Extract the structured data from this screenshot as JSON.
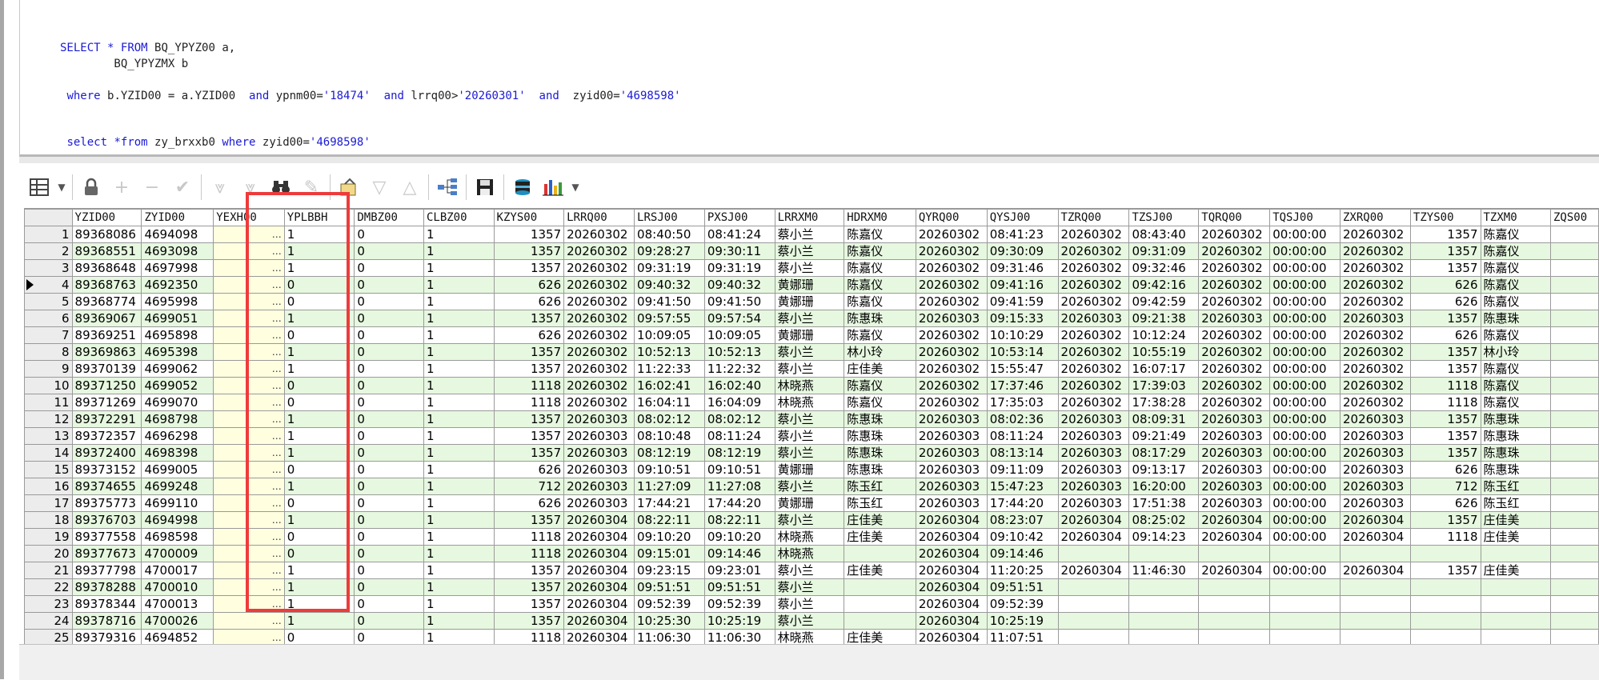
{
  "sql": {
    "line1": "SELECT * FROM BQ_YPYZ00 a,",
    "line2": "        BQ_YPYZMX b",
    "line3": " where b.YZID00 = a.YZID00  and ypnm00='18474'  and lrrq00>'20260301'  and  zyid00='4698598'",
    "line4": " select *from zy_brxxb0 where zyid00='4698598'"
  },
  "toolbar": {
    "icons": [
      "grid-icon",
      "dropdown-icon",
      "lock-icon",
      "plus-icon",
      "minus-icon",
      "check-icon",
      "down-double-icon",
      "down-double-icon",
      "binoculars-icon",
      "eraser-icon",
      "export-icon",
      "down-icon",
      "up-icon",
      "tree-icon",
      "save-icon",
      "db-icon",
      "chart-icon",
      "dropdown-icon"
    ]
  },
  "columns": [
    "YZID00",
    "ZYID00",
    "YEXH00",
    "YPLBBH",
    "DMBZ00",
    "CLBZ00",
    "KZYS00",
    "LRRQ00",
    "LRSJ00",
    "PXSJ00",
    "LRRXM0",
    "HDRXM0",
    "QYRQ00",
    "QYSJ00",
    "TZRQ00",
    "TZSJ00",
    "TQRQ00",
    "TQSJ00",
    "ZXRQ00",
    "TZYS00",
    "TZXM0",
    "ZQS00"
  ],
  "rows": [
    [
      "1",
      "89368086",
      "4694098",
      "…",
      "1",
      "0",
      "1",
      "1357",
      "20260302",
      "08:40:50",
      "08:41:24",
      "蔡小兰",
      "陈嘉仪",
      "20260302",
      "08:41:23",
      "20260302",
      "08:43:40",
      "20260302",
      "00:00:00",
      "20260302",
      "1357",
      "陈嘉仪"
    ],
    [
      "2",
      "89368551",
      "4693098",
      "…",
      "1",
      "0",
      "1",
      "1357",
      "20260302",
      "09:28:27",
      "09:30:11",
      "蔡小兰",
      "陈嘉仪",
      "20260302",
      "09:30:09",
      "20260302",
      "09:31:09",
      "20260302",
      "00:00:00",
      "20260302",
      "1357",
      "陈嘉仪"
    ],
    [
      "3",
      "89368648",
      "4697998",
      "…",
      "1",
      "0",
      "1",
      "1357",
      "20260302",
      "09:31:19",
      "09:31:19",
      "蔡小兰",
      "陈嘉仪",
      "20260302",
      "09:31:46",
      "20260302",
      "09:32:46",
      "20260302",
      "00:00:00",
      "20260302",
      "1357",
      "陈嘉仪"
    ],
    [
      "4",
      "89368763",
      "4692350",
      "…",
      "0",
      "0",
      "1",
      "626",
      "20260302",
      "09:40:32",
      "09:40:32",
      "黄娜珊",
      "陈嘉仪",
      "20260302",
      "09:41:16",
      "20260302",
      "09:42:16",
      "20260302",
      "00:00:00",
      "20260302",
      "626",
      "陈嘉仪"
    ],
    [
      "5",
      "89368774",
      "4695998",
      "…",
      "0",
      "0",
      "1",
      "626",
      "20260302",
      "09:41:50",
      "09:41:50",
      "黄娜珊",
      "陈嘉仪",
      "20260302",
      "09:41:59",
      "20260302",
      "09:42:59",
      "20260302",
      "00:00:00",
      "20260302",
      "626",
      "陈嘉仪"
    ],
    [
      "6",
      "89369067",
      "4699051",
      "…",
      "1",
      "0",
      "1",
      "1357",
      "20260302",
      "09:57:55",
      "09:57:54",
      "蔡小兰",
      "陈惠珠",
      "20260303",
      "09:15:33",
      "20260303",
      "09:21:38",
      "20260303",
      "00:00:00",
      "20260303",
      "1357",
      "陈惠珠"
    ],
    [
      "7",
      "89369251",
      "4695898",
      "…",
      "0",
      "0",
      "1",
      "626",
      "20260302",
      "10:09:05",
      "10:09:05",
      "黄娜珊",
      "陈嘉仪",
      "20260302",
      "10:10:29",
      "20260302",
      "10:12:24",
      "20260302",
      "00:00:00",
      "20260302",
      "626",
      "陈嘉仪"
    ],
    [
      "8",
      "89369863",
      "4695398",
      "…",
      "1",
      "0",
      "1",
      "1357",
      "20260302",
      "10:52:13",
      "10:52:13",
      "蔡小兰",
      "林小玲",
      "20260302",
      "10:53:14",
      "20260302",
      "10:55:19",
      "20260302",
      "00:00:00",
      "20260302",
      "1357",
      "林小玲"
    ],
    [
      "9",
      "89370139",
      "4699062",
      "…",
      "1",
      "0",
      "1",
      "1357",
      "20260302",
      "11:22:33",
      "11:22:32",
      "蔡小兰",
      "庄佳美",
      "20260302",
      "15:55:47",
      "20260302",
      "16:07:17",
      "20260302",
      "00:00:00",
      "20260302",
      "1357",
      "陈嘉仪"
    ],
    [
      "10",
      "89371250",
      "4699052",
      "…",
      "0",
      "0",
      "1",
      "1118",
      "20260302",
      "16:02:41",
      "16:02:40",
      "林晓燕",
      "陈嘉仪",
      "20260302",
      "17:37:46",
      "20260302",
      "17:39:03",
      "20260302",
      "00:00:00",
      "20260302",
      "1118",
      "陈嘉仪"
    ],
    [
      "11",
      "89371269",
      "4699070",
      "…",
      "0",
      "0",
      "1",
      "1118",
      "20260302",
      "16:04:11",
      "16:04:09",
      "林晓燕",
      "陈嘉仪",
      "20260302",
      "17:35:03",
      "20260302",
      "17:38:28",
      "20260302",
      "00:00:00",
      "20260302",
      "1118",
      "陈嘉仪"
    ],
    [
      "12",
      "89372291",
      "4698798",
      "…",
      "1",
      "0",
      "1",
      "1357",
      "20260303",
      "08:02:12",
      "08:02:12",
      "蔡小兰",
      "陈惠珠",
      "20260303",
      "08:02:36",
      "20260303",
      "08:09:31",
      "20260303",
      "00:00:00",
      "20260303",
      "1357",
      "陈惠珠"
    ],
    [
      "13",
      "89372357",
      "4696298",
      "…",
      "1",
      "0",
      "1",
      "1357",
      "20260303",
      "08:10:48",
      "08:11:24",
      "蔡小兰",
      "陈惠珠",
      "20260303",
      "08:11:24",
      "20260303",
      "09:21:49",
      "20260303",
      "00:00:00",
      "20260303",
      "1357",
      "陈惠珠"
    ],
    [
      "14",
      "89372400",
      "4698398",
      "…",
      "1",
      "0",
      "1",
      "1357",
      "20260303",
      "08:12:19",
      "08:12:19",
      "蔡小兰",
      "陈惠珠",
      "20260303",
      "08:13:14",
      "20260303",
      "08:17:29",
      "20260303",
      "00:00:00",
      "20260303",
      "1357",
      "陈惠珠"
    ],
    [
      "15",
      "89373152",
      "4699005",
      "…",
      "0",
      "0",
      "1",
      "626",
      "20260303",
      "09:10:51",
      "09:10:51",
      "黄娜珊",
      "陈惠珠",
      "20260303",
      "09:11:09",
      "20260303",
      "09:13:17",
      "20260303",
      "00:00:00",
      "20260303",
      "626",
      "陈惠珠"
    ],
    [
      "16",
      "89374655",
      "4699248",
      "…",
      "1",
      "0",
      "1",
      "712",
      "20260303",
      "11:27:09",
      "11:27:08",
      "蔡小兰",
      "陈玉红",
      "20260303",
      "15:47:23",
      "20260303",
      "16:20:00",
      "20260303",
      "00:00:00",
      "20260303",
      "712",
      "陈玉红"
    ],
    [
      "17",
      "89375773",
      "4699110",
      "…",
      "0",
      "0",
      "1",
      "626",
      "20260303",
      "17:44:21",
      "17:44:20",
      "黄娜珊",
      "陈玉红",
      "20260303",
      "17:44:20",
      "20260303",
      "17:51:38",
      "20260303",
      "00:00:00",
      "20260303",
      "626",
      "陈玉红"
    ],
    [
      "18",
      "89376703",
      "4694998",
      "…",
      "1",
      "0",
      "1",
      "1357",
      "20260304",
      "08:22:11",
      "08:22:11",
      "蔡小兰",
      "庄佳美",
      "20260304",
      "08:23:07",
      "20260304",
      "08:25:02",
      "20260304",
      "00:00:00",
      "20260304",
      "1357",
      "庄佳美"
    ],
    [
      "19",
      "89377558",
      "4698598",
      "…",
      "0",
      "0",
      "1",
      "1118",
      "20260304",
      "09:10:20",
      "09:10:20",
      "林晓燕",
      "庄佳美",
      "20260304",
      "09:10:42",
      "20260304",
      "09:14:23",
      "20260304",
      "00:00:00",
      "20260304",
      "1118",
      "庄佳美"
    ],
    [
      "20",
      "89377673",
      "4700009",
      "…",
      "0",
      "0",
      "1",
      "1118",
      "20260304",
      "09:15:01",
      "09:14:46",
      "林晓燕",
      "",
      "20260304",
      "09:14:46",
      "",
      "",
      "",
      "",
      "",
      "",
      ""
    ],
    [
      "21",
      "89377798",
      "4700017",
      "…",
      "1",
      "0",
      "1",
      "1357",
      "20260304",
      "09:23:15",
      "09:23:01",
      "蔡小兰",
      "庄佳美",
      "20260304",
      "11:20:25",
      "20260304",
      "11:46:30",
      "20260304",
      "00:00:00",
      "20260304",
      "1357",
      "庄佳美"
    ],
    [
      "22",
      "89378288",
      "4700010",
      "…",
      "1",
      "0",
      "1",
      "1357",
      "20260304",
      "09:51:51",
      "09:51:51",
      "蔡小兰",
      "",
      "20260304",
      "09:51:51",
      "",
      "",
      "",
      "",
      "",
      "",
      ""
    ],
    [
      "23",
      "89378344",
      "4700013",
      "…",
      "1",
      "0",
      "1",
      "1357",
      "20260304",
      "09:52:39",
      "09:52:39",
      "蔡小兰",
      "",
      "20260304",
      "09:52:39",
      "",
      "",
      "",
      "",
      "",
      "",
      ""
    ],
    [
      "24",
      "89378716",
      "4700026",
      "…",
      "1",
      "0",
      "1",
      "1357",
      "20260304",
      "10:25:30",
      "10:25:19",
      "蔡小兰",
      "",
      "20260304",
      "10:25:19",
      "",
      "",
      "",
      "",
      "",
      "",
      ""
    ],
    [
      "25",
      "89379316",
      "4694852",
      "…",
      "0",
      "0",
      "1",
      "1118",
      "20260304",
      "11:06:30",
      "11:06:30",
      "林晓燕",
      "庄佳美",
      "20260304",
      "11:07:51",
      "",
      "",
      "",
      "",
      "",
      "",
      ""
    ]
  ]
}
